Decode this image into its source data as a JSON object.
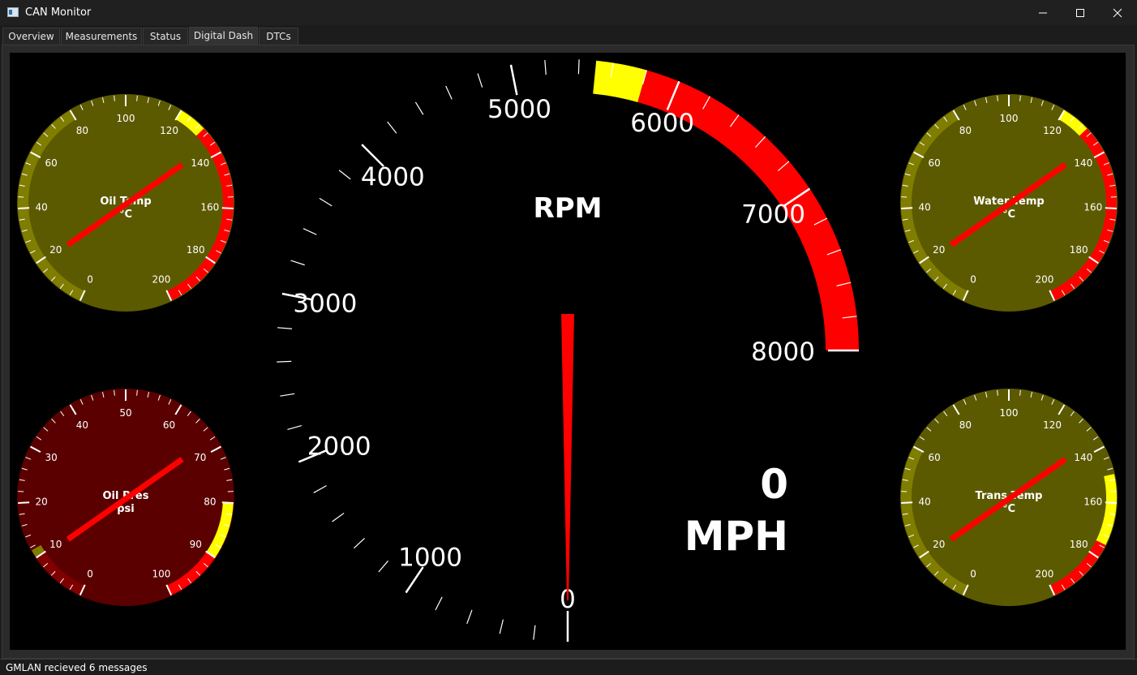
{
  "window": {
    "title": "CAN Monitor",
    "icon": "app-window-icon",
    "controls": [
      "minimize-icon",
      "maximize-icon",
      "close-icon"
    ]
  },
  "tabs": [
    {
      "label": "Overview",
      "active": false
    },
    {
      "label": "Measurements",
      "active": false
    },
    {
      "label": "Status",
      "active": false
    },
    {
      "label": "Digital Dash",
      "active": true
    },
    {
      "label": "DTCs",
      "active": false
    }
  ],
  "dash": {
    "rpm_gauge": {
      "title": "RPM",
      "min": 0,
      "max": 8000,
      "value": 0,
      "tick_labels": [
        "0",
        "1000",
        "2000",
        "3000",
        "4000",
        "5000",
        "6000",
        "7000",
        "8000"
      ],
      "zones": [
        {
          "from": 5500,
          "to": 5800,
          "color": "#ffff00"
        },
        {
          "from": 5800,
          "to": 8000,
          "color": "#ff0000"
        }
      ],
      "needle_color": "#ff0000"
    },
    "speed": {
      "value": "0",
      "unit": "MPH"
    },
    "gauges": [
      {
        "id": "oil-temp",
        "title": "Oil Temp",
        "unit": "°C",
        "min": 0,
        "max": 200,
        "value": 20,
        "tick_labels": [
          "0",
          "20",
          "40",
          "60",
          "80",
          "100",
          "120",
          "140",
          "160",
          "180",
          "200"
        ],
        "face_color": "#5c5a00",
        "zones": [
          {
            "from": 0,
            "to": 80,
            "color": "#807e00"
          },
          {
            "from": 120,
            "to": 130,
            "color": "#ffff00"
          },
          {
            "from": 130,
            "to": 200,
            "color": "#ff0000"
          }
        ]
      },
      {
        "id": "water-temp",
        "title": "Water Temp",
        "unit": "°C",
        "min": 0,
        "max": 200,
        "value": 20,
        "tick_labels": [
          "0",
          "20",
          "40",
          "60",
          "80",
          "100",
          "120",
          "140",
          "160",
          "180",
          "200"
        ],
        "face_color": "#5c5a00",
        "zones": [
          {
            "from": 0,
            "to": 80,
            "color": "#807e00"
          },
          {
            "from": 120,
            "to": 130,
            "color": "#ffff00"
          },
          {
            "from": 130,
            "to": 200,
            "color": "#ff0000"
          }
        ]
      },
      {
        "id": "oil-pres",
        "title": "Oil Pres",
        "unit": "psi",
        "min": 0,
        "max": 100,
        "value": 10,
        "tick_labels": [
          "0",
          "10",
          "20",
          "30",
          "40",
          "50",
          "60",
          "70",
          "80",
          "90",
          "100"
        ],
        "face_color": "#5a0000",
        "zones": [
          {
            "from": 0,
            "to": 10,
            "color": "#800000"
          },
          {
            "from": 10,
            "to": 11.5,
            "color": "#807e00"
          },
          {
            "from": 80,
            "to": 90,
            "color": "#ffff00"
          },
          {
            "from": 90,
            "to": 100,
            "color": "#ff0000"
          }
        ]
      },
      {
        "id": "trans-temp",
        "title": "Trans Temp",
        "unit": "°C",
        "min": 0,
        "max": 200,
        "value": 20,
        "tick_labels": [
          "0",
          "20",
          "40",
          "60",
          "80",
          "100",
          "120",
          "140",
          "160",
          "180",
          "200"
        ],
        "face_color": "#5c5a00",
        "zones": [
          {
            "from": 0,
            "to": 60,
            "color": "#807e00"
          },
          {
            "from": 150,
            "to": 175,
            "color": "#ffff00"
          },
          {
            "from": 175,
            "to": 200,
            "color": "#ff0000"
          }
        ]
      }
    ]
  },
  "status": {
    "text": "GMLAN recieved 6 messages"
  }
}
